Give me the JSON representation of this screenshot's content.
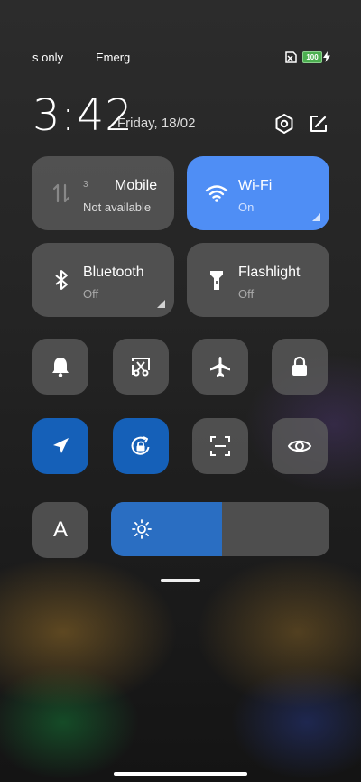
{
  "status_bar": {
    "left_text": "s only",
    "emergency_text": "Emerg",
    "battery_level": "100"
  },
  "header": {
    "time": "3:42",
    "date": "Friday, 18/02"
  },
  "tiles": {
    "mobile": {
      "title": "Mobile",
      "subtitle": "Not available",
      "badge": "3"
    },
    "wifi": {
      "title": "Wi-Fi",
      "subtitle": "On"
    },
    "bluetooth": {
      "title": "Bluetooth",
      "subtitle": "Off"
    },
    "flashlight": {
      "title": "Flashlight",
      "subtitle": "Off"
    }
  },
  "toggles": {
    "reading_mode_label": "A",
    "row1": [
      "bell-icon",
      "screenshot-icon",
      "airplane-icon",
      "lock-icon"
    ],
    "row2": [
      "location-icon",
      "auto-rotate-icon",
      "scanner-icon",
      "eye-icon"
    ]
  },
  "brightness": {
    "level": 0.51
  },
  "colors": {
    "wifi_active": "#4f8ef5",
    "toggle_active": "#1560b8",
    "battery": "#4caf50"
  }
}
